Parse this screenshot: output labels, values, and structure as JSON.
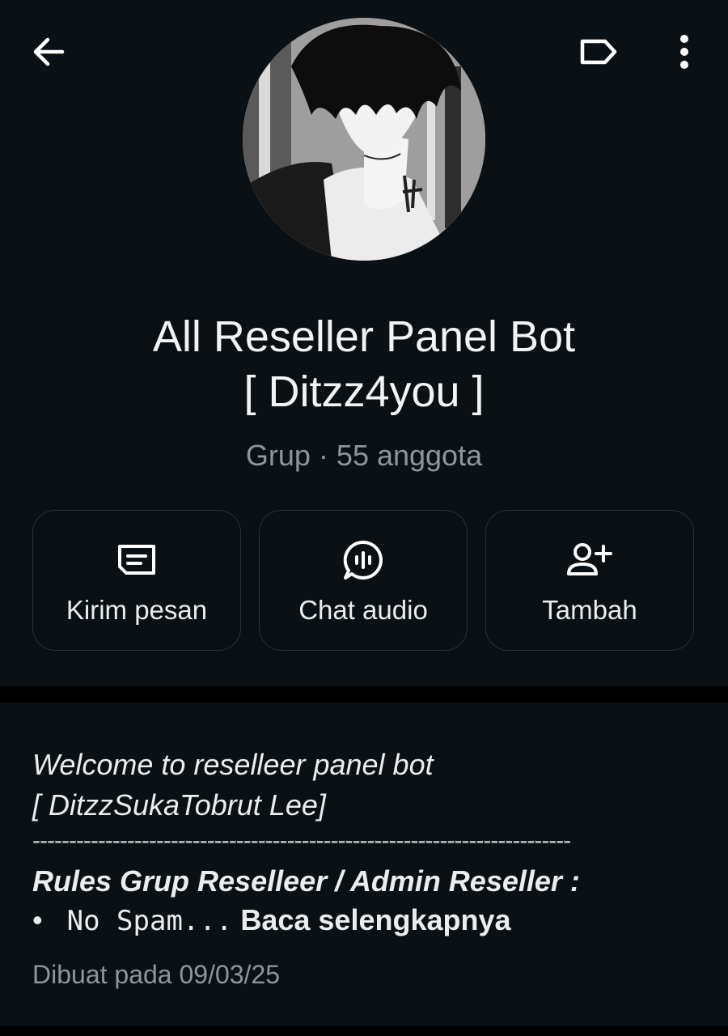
{
  "header": {
    "back_icon": "arrow-left-icon",
    "label_icon": "label-tag-icon",
    "menu_icon": "more-vertical-icon"
  },
  "group": {
    "title_line1": "All Reseller Panel Bot",
    "title_line2": "[ Ditzz4you ]",
    "subtitle": "Grup · 55 anggota"
  },
  "actions": [
    {
      "label": "Kirim pesan",
      "icon": "message-icon"
    },
    {
      "label": "Chat audio",
      "icon": "audio-chat-icon"
    },
    {
      "label": "Tambah",
      "icon": "add-person-icon"
    }
  ],
  "description": {
    "line1": "Welcome to reselleer panel bot",
    "line2": "[ DitzzSukaTobrut Lee]",
    "line3": "--------------------------------------------------------------------------",
    "line4": "Rules Grup Reselleer / Admin Reseller :",
    "bullet": "•",
    "bullet_text": "No Spam...",
    "read_more": "Baca selengkapnya"
  },
  "created": "Dibuat pada 09/03/25",
  "colors": {
    "background": "#0b1014",
    "text": "#e9edef",
    "muted": "#8d969b",
    "card_border": "#2b3338"
  }
}
